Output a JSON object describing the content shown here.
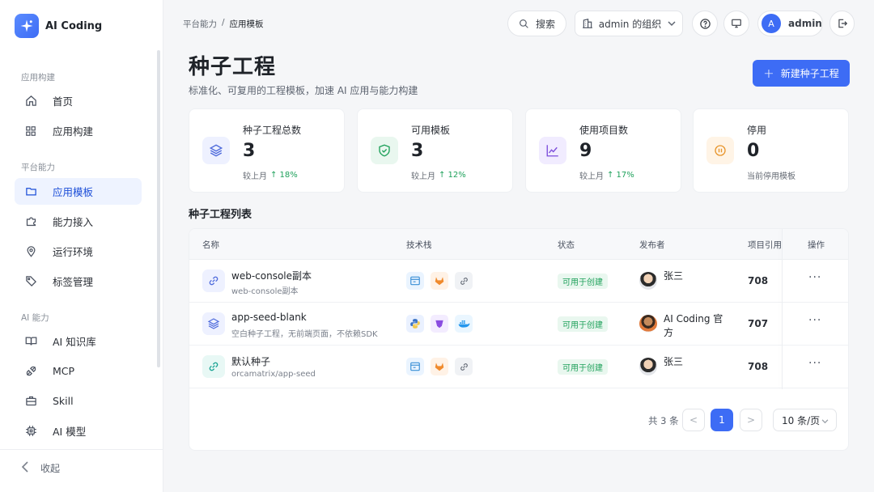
{
  "brand": {
    "name": "AI Coding"
  },
  "sidebar": {
    "sections": [
      "应用构建",
      "平台能力",
      "AI 能力"
    ],
    "items": [
      {
        "label": "首页",
        "icon": "home-icon"
      },
      {
        "label": "应用构建",
        "icon": "grid-icon"
      },
      {
        "label": "应用模板",
        "icon": "folder-icon",
        "active": true
      },
      {
        "label": "能力接入",
        "icon": "puzzle-icon"
      },
      {
        "label": "运行环境",
        "icon": "location-icon"
      },
      {
        "label": "标签管理",
        "icon": "tag-icon"
      },
      {
        "label": "AI 知识库",
        "icon": "book-icon"
      },
      {
        "label": "MCP",
        "icon": "plug-icon"
      },
      {
        "label": "Skill",
        "icon": "briefcase-icon"
      },
      {
        "label": "AI 模型",
        "icon": "chip-icon"
      }
    ],
    "collapse_label": "收起"
  },
  "header": {
    "breadcrumb": [
      "平台能力",
      "/",
      "应用模板"
    ],
    "search_label": "搜索",
    "org_label": "admin 的组织",
    "user": {
      "initial": "A",
      "name": "admin"
    }
  },
  "page": {
    "title": "种子工程",
    "subtitle": "标准化、可复用的工程模板，加速 AI 应用与能力构建",
    "new_button": "新建种子工程"
  },
  "stats": [
    {
      "label": "种子工程总数",
      "value": "3",
      "foot_prefix": "较上月",
      "foot_trend": "↑ 18%",
      "color": "#eef1ff",
      "icon": "layers-icon"
    },
    {
      "label": "可用模板",
      "value": "3",
      "foot_prefix": "较上月",
      "foot_trend": "↑ 12%",
      "color": "#e9f7ef",
      "icon": "shield-check-icon"
    },
    {
      "label": "使用项目数",
      "value": "9",
      "foot_prefix": "较上月",
      "foot_trend": "↑ 17%",
      "color": "#f1ecff",
      "icon": "trend-chart-icon"
    },
    {
      "label": "停用",
      "value": "0",
      "foot_prefix": "当前停用模板",
      "foot_trend": "",
      "color": "#fff4e6",
      "icon": "pause-icon"
    }
  ],
  "table": {
    "heading": "种子工程列表",
    "columns": [
      "名称",
      "技术栈",
      "状态",
      "发布者",
      "项目引用",
      "操作"
    ],
    "rows": [
      {
        "name": "web-console副本",
        "desc": "web-console副本",
        "status": "可用于创建",
        "publisher": "张三",
        "refs": "708",
        "more": "···"
      },
      {
        "name": "app-seed-blank",
        "desc": "空白种子工程，无前端页面，不依赖SDK",
        "status": "可用于创建",
        "publisher": "AI Coding 官方",
        "refs": "707",
        "more": "···"
      },
      {
        "name": "默认种子",
        "desc": "orcamatrix/app-seed",
        "status": "可用于创建",
        "publisher": "张三",
        "refs": "708",
        "more": "···"
      }
    ],
    "pagination": {
      "total": "共 3 条",
      "prev": "<",
      "current": "1",
      "next": ">",
      "page_size": "10 条/页"
    }
  },
  "colors": {
    "accent": "#3d6cf5",
    "success": "#1fa15b"
  }
}
